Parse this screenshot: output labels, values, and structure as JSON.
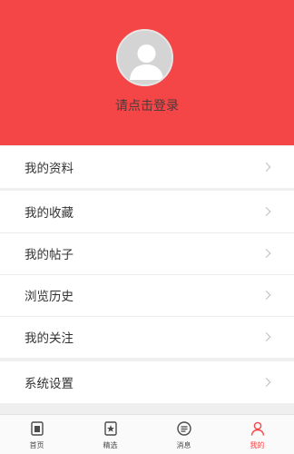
{
  "header": {
    "login_prompt": "请点击登录",
    "bg_color": "#f44547"
  },
  "menu": {
    "group1": [
      {
        "label": "我的资料"
      }
    ],
    "group2": [
      {
        "label": "我的收藏"
      },
      {
        "label": "我的帖子"
      },
      {
        "label": "浏览历史"
      },
      {
        "label": "我的关注"
      }
    ],
    "group3": [
      {
        "label": "系统设置"
      }
    ]
  },
  "tabbar": {
    "tabs": [
      {
        "label": "首页",
        "icon": "home-icon"
      },
      {
        "label": "精选",
        "icon": "featured-icon"
      },
      {
        "label": "消息",
        "icon": "message-icon"
      },
      {
        "label": "我的",
        "icon": "profile-icon",
        "active": true
      }
    ],
    "active_color": "#f44547"
  }
}
